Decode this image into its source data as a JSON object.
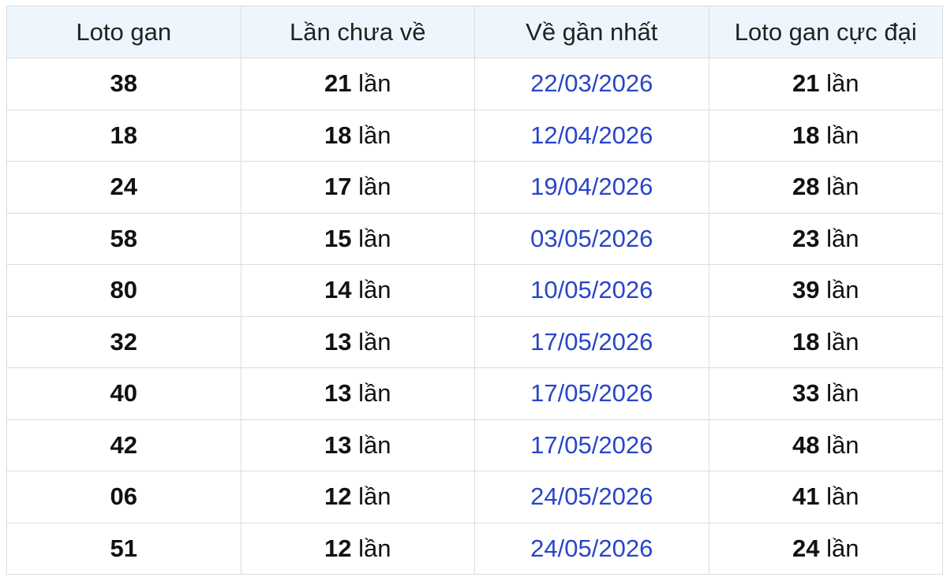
{
  "table": {
    "headers": [
      "Loto gan",
      "Lần chưa về",
      "Về gần nhất",
      "Loto gan cực đại"
    ],
    "unit": "lần",
    "rows": [
      {
        "loto": "38",
        "missed": "21",
        "last_seen": "22/03/2026",
        "max_gap": "21"
      },
      {
        "loto": "18",
        "missed": "18",
        "last_seen": "12/04/2026",
        "max_gap": "18"
      },
      {
        "loto": "24",
        "missed": "17",
        "last_seen": "19/04/2026",
        "max_gap": "28"
      },
      {
        "loto": "58",
        "missed": "15",
        "last_seen": "03/05/2026",
        "max_gap": "23"
      },
      {
        "loto": "80",
        "missed": "14",
        "last_seen": "10/05/2026",
        "max_gap": "39"
      },
      {
        "loto": "32",
        "missed": "13",
        "last_seen": "17/05/2026",
        "max_gap": "18"
      },
      {
        "loto": "40",
        "missed": "13",
        "last_seen": "17/05/2026",
        "max_gap": "33"
      },
      {
        "loto": "42",
        "missed": "13",
        "last_seen": "17/05/2026",
        "max_gap": "48"
      },
      {
        "loto": "06",
        "missed": "12",
        "last_seen": "24/05/2026",
        "max_gap": "41"
      },
      {
        "loto": "51",
        "missed": "12",
        "last_seen": "24/05/2026",
        "max_gap": "24"
      }
    ]
  },
  "colors": {
    "header_bg": "#eef6fd",
    "date_link": "#2845c8",
    "border": "#dcdcdc"
  }
}
